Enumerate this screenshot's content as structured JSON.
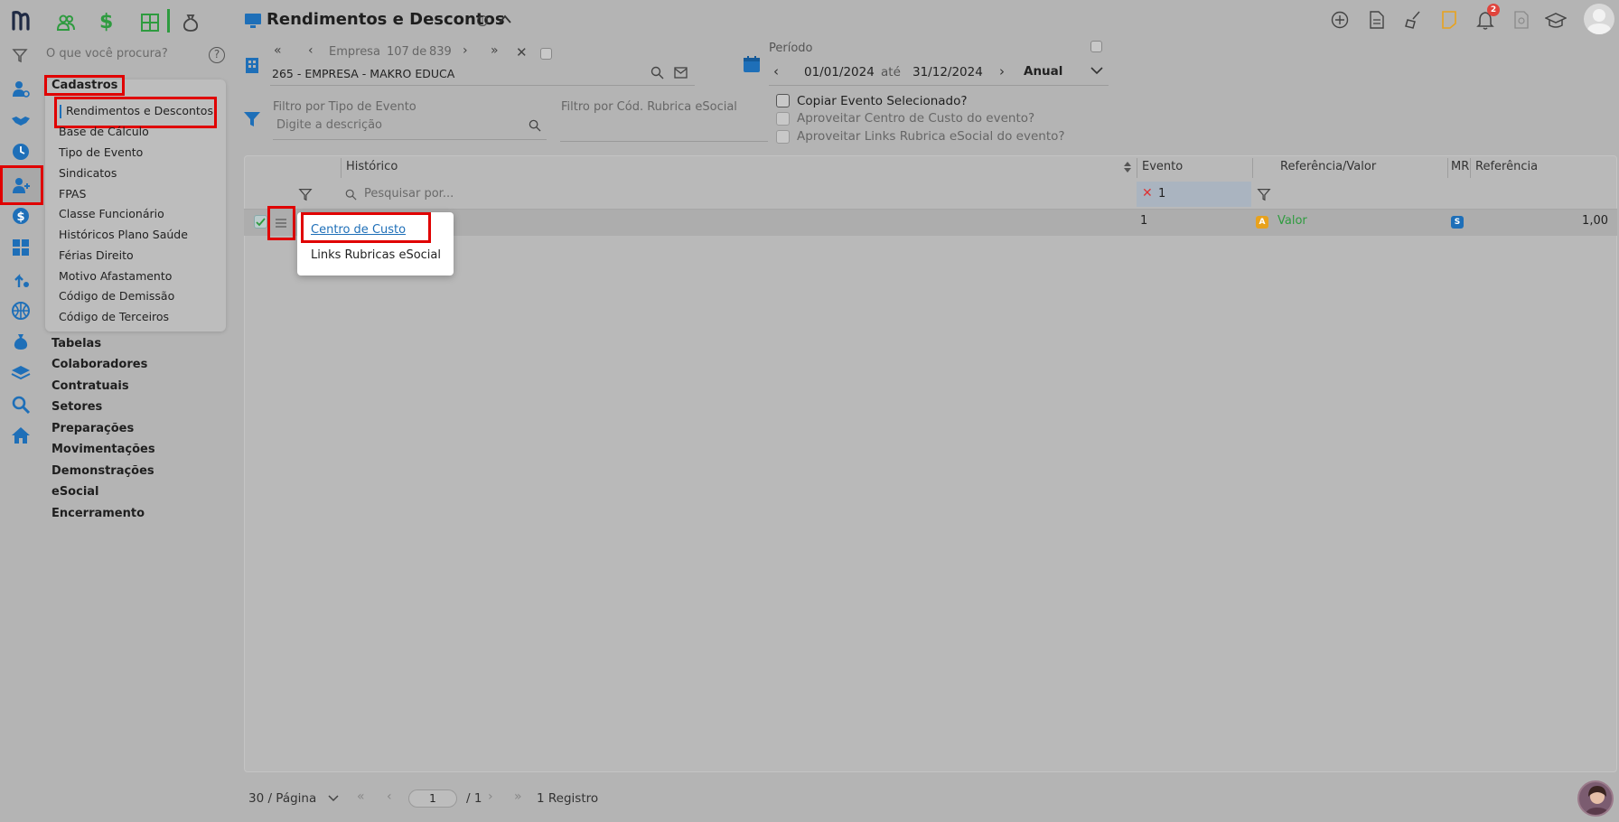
{
  "header": {
    "title": "Rendimentos e Descontos",
    "notification_count": "2"
  },
  "search": {
    "placeholder": "O que você procura?"
  },
  "menu": {
    "cadastros_label": "Cadastros",
    "cadastros_items": [
      "Rendimentos e Descontos",
      "Base de Cálculo",
      "Tipo de Evento",
      "Sindicatos",
      "FPAS",
      "Classe Funcionário",
      "Históricos Plano Saúde",
      "Férias Direito",
      "Motivo Afastamento",
      "Código de Demissão",
      "Código de Terceiros"
    ],
    "sections": [
      "Tabelas",
      "Colaboradores",
      "Contratuais",
      "Setores",
      "Preparações",
      "Movimentações",
      "Demonstrações",
      "eSocial",
      "Encerramento"
    ]
  },
  "company": {
    "nav_label": "Empresa",
    "current": "107",
    "of_label": "de",
    "total": "839",
    "name": "265 - EMPRESA - MAKRO EDUCA"
  },
  "period": {
    "label": "Período",
    "start": "01/01/2024",
    "until_label": "até",
    "end": "31/12/2024",
    "type": "Anual"
  },
  "filters": {
    "event_type_label": "Filtro por Tipo de Evento",
    "event_type_placeholder": "Digite a descrição",
    "rubrica_label": "Filtro por Cód. Rubrica eSocial",
    "copy_event_label": "Copiar Evento Selecionado?",
    "reuse_cost_center_label": "Aproveitar Centro de Custo do evento?",
    "reuse_links_label": "Aproveitar Links Rubrica eSocial do evento?"
  },
  "table": {
    "columns": {
      "historico": "Histórico",
      "evento": "Evento",
      "ref_valor": "Referência/Valor",
      "mr": "MR",
      "referencia": "Referência"
    },
    "search_placeholder": "Pesquisar por...",
    "evento_filter_value": "1",
    "rows": [
      {
        "evento": "1",
        "badge": "A",
        "ref_valor": "Valor",
        "mr_badge": "S",
        "referencia": "1,00"
      }
    ]
  },
  "context_menu": {
    "items": [
      "Centro de Custo",
      "Links Rubricas eSocial"
    ]
  },
  "pagination": {
    "per_page": "30 / Página",
    "page": "1",
    "of_pages": "/ 1",
    "records": "1 Registro"
  },
  "colors": {
    "accent_blue": "#1e6fb8",
    "highlight_red": "#e00000",
    "green": "#2e9b3f",
    "badge_orange": "#e8a21d",
    "background": "#b4b4b4"
  }
}
